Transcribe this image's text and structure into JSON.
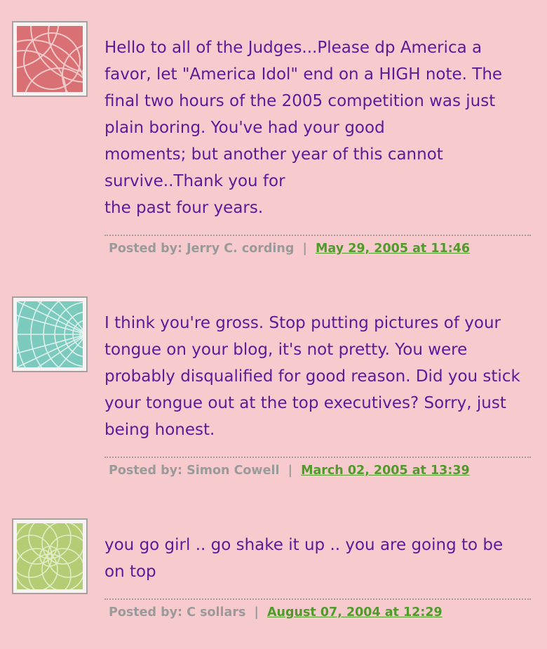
{
  "comments": [
    {
      "lines": [
        "Hello to all of the Judges...Please dp America a",
        "favor, let \"America Idol\" end on a HIGH note. The",
        "final two hours of the 2005 competition was just",
        "plain boring. You've had your good",
        "moments; but another year of this cannot",
        "survive..Thank you for",
        "the past four years."
      ],
      "posted_by_label": "Posted by:",
      "author": "Jerry C. cording",
      "separator": "|",
      "timestamp": "May 29, 2005 at 11:46",
      "avatar_icon": "red-circles-pattern-icon",
      "avatar_color": "#d87074"
    },
    {
      "lines": [
        "I think you're gross. Stop putting pictures of your",
        "tongue on your blog, it's not pretty. You were",
        "probably disqualified for good reason. Did you stick",
        "your tongue out at the top executives? Sorry, just",
        "being honest."
      ],
      "posted_by_label": "Posted by:",
      "author": "Simon Cowell",
      "separator": "|",
      "timestamp": "March 02, 2005 at 13:39",
      "avatar_icon": "teal-spiral-pattern-icon",
      "avatar_color": "#7ccabe"
    },
    {
      "lines": [
        "you go girl .. go shake it up .. you are going to be",
        "on top"
      ],
      "posted_by_label": "Posted by:",
      "author": "C sollars",
      "separator": "|",
      "timestamp": "August 07, 2004 at 12:29",
      "avatar_icon": "green-flower-pattern-icon",
      "avatar_color": "#b4cc74"
    }
  ]
}
